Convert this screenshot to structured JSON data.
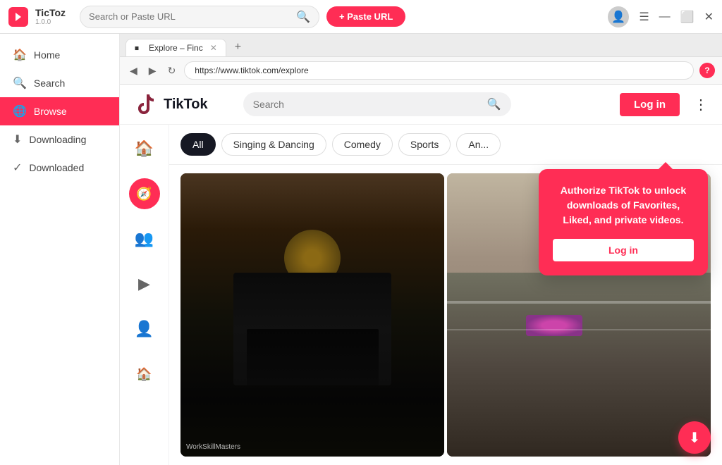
{
  "app": {
    "name": "TicToz",
    "version": "1.0.0",
    "logo_bg": "#ff2d55"
  },
  "titlebar": {
    "search_placeholder": "Search or Paste URL",
    "paste_url_label": "+ Paste URL",
    "window_controls": [
      "☰",
      "—",
      "⬜",
      "✕"
    ]
  },
  "sidebar": {
    "items": [
      {
        "id": "home",
        "label": "Home",
        "icon": "🏠"
      },
      {
        "id": "search",
        "label": "Search",
        "icon": "🔍"
      },
      {
        "id": "browse",
        "label": "Browse",
        "icon": "🌐",
        "active": true
      },
      {
        "id": "downloading",
        "label": "Downloading",
        "icon": "⬇"
      },
      {
        "id": "downloaded",
        "label": "Downloaded",
        "icon": "✓"
      }
    ]
  },
  "browser": {
    "tab": {
      "favicon": "T",
      "title": "Explore – Finc",
      "url": "https://www.tiktok.com/explore"
    },
    "new_tab_label": "+"
  },
  "tiktok": {
    "logo_text": "TikTok",
    "search_placeholder": "Search",
    "login_btn": "Log in",
    "categories": [
      {
        "id": "all",
        "label": "All",
        "active": true
      },
      {
        "id": "singing",
        "label": "Singing & Dancing"
      },
      {
        "id": "comedy",
        "label": "Comedy"
      },
      {
        "id": "sports",
        "label": "Sports"
      },
      {
        "id": "anime",
        "label": "An..."
      }
    ],
    "nav_icons": [
      "🏠",
      "🧭",
      "👥",
      "▶",
      "👤",
      "🏠"
    ]
  },
  "auth_popup": {
    "text": "Authorize TikTok to unlock downloads of Favorites, Liked, and private videos.",
    "login_label": "Log in"
  },
  "video1_label": "WorkSkillMasters",
  "video2_label": ""
}
